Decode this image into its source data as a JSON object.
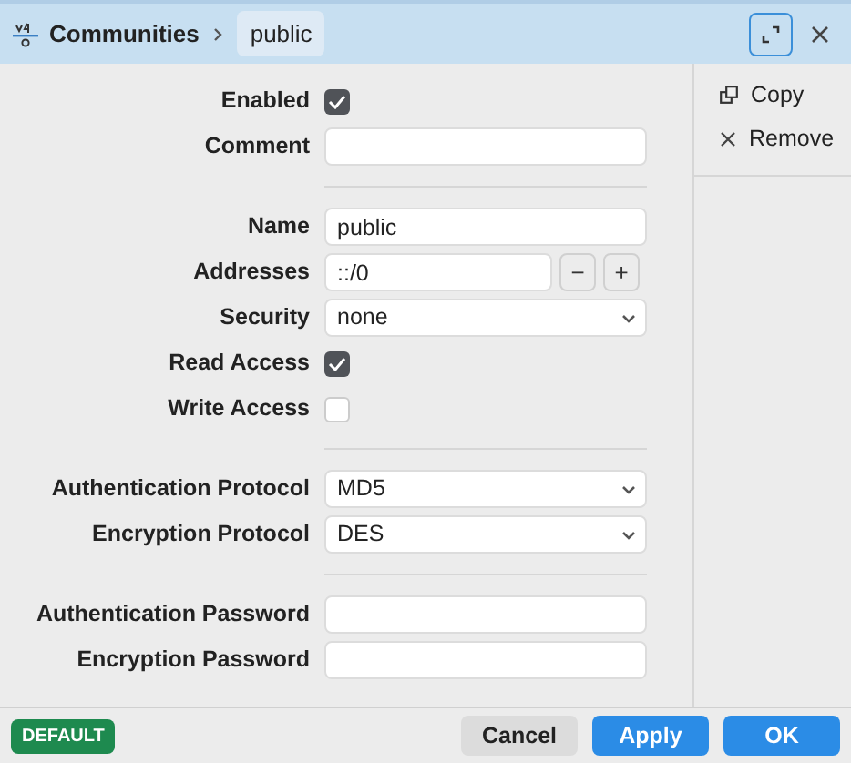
{
  "header": {
    "title": "Communities",
    "breadcrumb": "public"
  },
  "sections": [
    {
      "fields": [
        {
          "kind": "checkbox",
          "label": "Enabled",
          "checked": true
        },
        {
          "kind": "text",
          "label": "Comment"
        }
      ]
    },
    {
      "fields": [
        {
          "kind": "text",
          "label": "Name",
          "value": "public"
        },
        {
          "kind": "address",
          "label": "Addresses",
          "value": "::/0",
          "remove": "−",
          "add": "+"
        },
        {
          "kind": "select",
          "label": "Security",
          "value": "none"
        },
        {
          "kind": "checkbox",
          "label": "Read Access",
          "checked": true
        },
        {
          "kind": "checkbox",
          "label": "Write Access",
          "checked": false
        }
      ]
    },
    {
      "fields": [
        {
          "kind": "select",
          "label": "Authentication Protocol",
          "value": "MD5"
        },
        {
          "kind": "select",
          "label": "Encryption Protocol",
          "value": "DES"
        }
      ]
    },
    {
      "fields": [
        {
          "kind": "text",
          "label": "Authentication Password"
        },
        {
          "kind": "text",
          "label": "Encryption Password"
        }
      ]
    }
  ],
  "sidebar": {
    "items": [
      {
        "kind": "copy",
        "label": "Copy"
      },
      {
        "kind": "remove",
        "label": "Remove"
      }
    ]
  },
  "footer": {
    "badge": "DEFAULT",
    "buttons": [
      {
        "kind": "secondary",
        "label": "Cancel"
      },
      {
        "kind": "primary",
        "label": "Apply"
      },
      {
        "kind": "primary",
        "label": "OK"
      }
    ]
  }
}
